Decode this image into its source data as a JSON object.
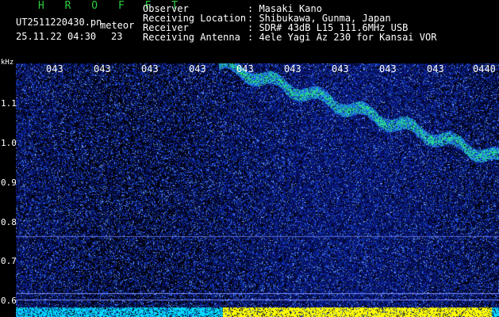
{
  "header": {
    "app_title": "H R O F F T",
    "filename": "UT2511220430.pn",
    "meteor_label": "meteor",
    "datetime": "25.11.22 04:30",
    "count": "23"
  },
  "meta": [
    {
      "key": "Observer",
      "value": ": Masaki Kano"
    },
    {
      "key": "Receiving Location",
      "value": ": Shibukawa, Gunma, Japan"
    },
    {
      "key": "Receiver",
      "value": ": SDR# 43dB L15 111.6MHz USB"
    },
    {
      "key": "Receiving Antenna",
      "value": ": 4ele Yagi Az 230 for Kansai VOR"
    }
  ],
  "axis": {
    "unit": "kHz",
    "ticks": [
      "1.1",
      "1.0",
      "0.9",
      "0.8",
      "0.7",
      "0.6"
    ]
  },
  "time_labels": [
    "043",
    "043",
    "043",
    "043",
    "043",
    "043",
    "043",
    "043",
    "043",
    "0440"
  ],
  "colors": {
    "background": "#000000",
    "noise_low": "#0a1a6e",
    "noise_mid": "#1f4fd8",
    "signal": "#3fe0a0",
    "baseline_yellow": "#ffff00",
    "baseline_cyan": "#00e0ff"
  }
}
